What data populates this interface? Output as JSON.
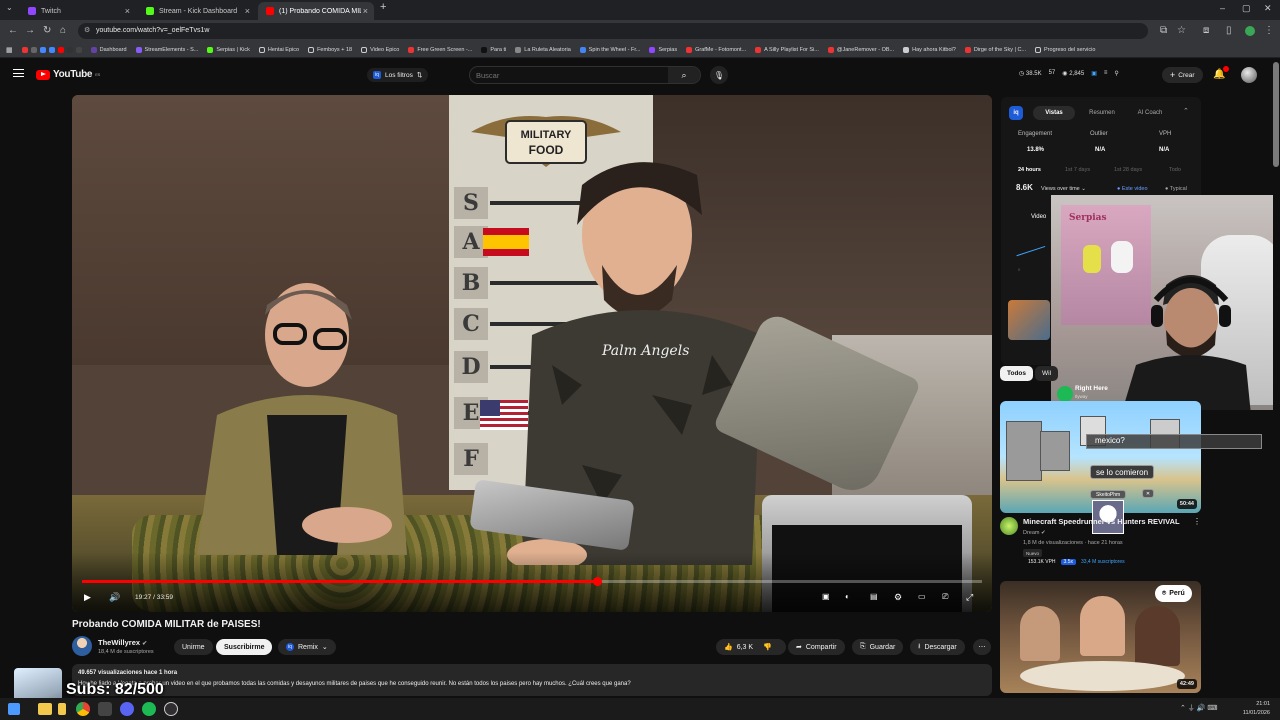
{
  "browser": {
    "tabs": [
      {
        "label": "Twitch",
        "color": "#9146ff",
        "active": false
      },
      {
        "label": "Stream - Kick Dashboard",
        "color": "#53fc18",
        "active": false
      },
      {
        "label": "(1) Probando COMIDA MILITAR...",
        "color": "#ff0000",
        "active": true
      }
    ],
    "new_tab": "+",
    "url": "youtube.com/watch?v=_oelFeTvs1w",
    "bookmarks": [
      "Dashboard",
      "StreamElements - S...",
      "Serpias | Kick",
      "Hentai Epico",
      "Femboys + 18",
      "Video Epico",
      "Free Green Screen -...",
      "Para ti",
      "La Ruleta Aleatoria",
      "Spin the Wheel - Fr...",
      "Serpias",
      "GrafMe - Fotomont...",
      "A Silly Playlist For Si...",
      "@JaneRemover - OB...",
      "Hay ahora Kitbol?",
      "Dirge of the Sky | C...",
      "Progreso del servicio"
    ]
  },
  "youtube": {
    "logo_text": "YouTube",
    "logo_region": "ES",
    "filter_label": "Los filtros",
    "search_placeholder": "Buscar",
    "stats": [
      "38.5K",
      "57",
      "2,845"
    ],
    "create_label": "Crear",
    "video": {
      "title": "Probando COMIDA MILITAR de PAISES!",
      "time_current": "19:27",
      "time_total": "33:59",
      "progress": 0.572,
      "board_logo_top": "MILITARY",
      "board_logo_bottom": "FOOD",
      "tiers": [
        "S",
        "A",
        "B",
        "C",
        "D",
        "E",
        "F"
      ]
    },
    "channel": {
      "name": "TheWillyrex",
      "subs": "18,4 M de suscriptores",
      "join_label": "Unirme",
      "subscribe_label": "Suscribirme",
      "remix_label": "Remix"
    },
    "actions": {
      "likes": "6,3 K",
      "share": "Compartir",
      "save": "Guardar",
      "download": "Descargar"
    },
    "description": {
      "meta": "49.657 visualizaciones  hace 1 hora",
      "text": "Hoy he liado a Vegeta a probar un video en el que probamos todas las comidas y desayunos militares de paises que he conseguido reunir. No están todos los paises pero hay muchos. ¿Cuál crees que gana?"
    },
    "analytics": {
      "tabs": [
        "Vistas",
        "Resumen",
        "AI Coach"
      ],
      "metrics": [
        {
          "label": "Engagement",
          "value": "13.8%"
        },
        {
          "label": "Outlier",
          "value": "N/A"
        },
        {
          "label": "VPH",
          "value": "N/A"
        }
      ],
      "ranges": [
        "24 hours",
        "1st 7 days",
        "1st 28 days",
        "Todo"
      ],
      "views": "8.6K",
      "views_label": "Views over time",
      "este_video": "Este video",
      "tipical": "Typical",
      "video_label": "Video"
    },
    "chips": [
      "Todos",
      "Wil"
    ],
    "recommendations": [
      {
        "title": "Minecraft Speedrunner vs Hunters REVIVAL",
        "channel": "Dream",
        "meta": "1,8 M de visualizaciones · hace 21 horas",
        "badge": "Nuevo",
        "vph": "153.1K VPH",
        "multiplier": "3.5x",
        "subs": "33,4 M suscriptores",
        "duration": "50:44"
      },
      {
        "title": "",
        "location": "Perú",
        "duration": "42:49"
      }
    ]
  },
  "overlays": {
    "spotify_song": "Right Here",
    "spotify_artist": "Ilyway",
    "chat": [
      "mexico?",
      "se lo comieron"
    ],
    "chat_user": "SkeitoPhm",
    "subs_goal": "Subs: 82/500",
    "cam_text": "Serpias"
  },
  "taskbar": {
    "time": "21:01",
    "date": "11/01/2026"
  },
  "colors": {
    "accent": "#ff0000",
    "blue": "#3ea6ff",
    "iq": "#1e5bd8"
  }
}
